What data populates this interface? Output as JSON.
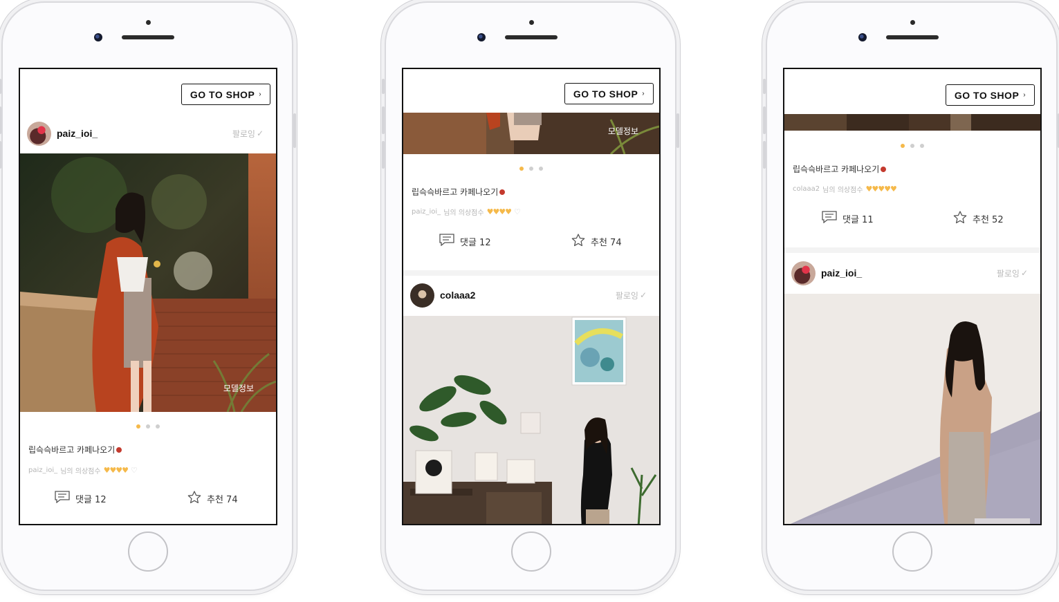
{
  "shop_button": {
    "label": "GO TO SHOP",
    "chevron": "›"
  },
  "follow_label": "팔로잉",
  "follow_icon": "✓",
  "model_info": "모델정보",
  "caption": "립슥슥바르고 카페나오기",
  "score_suffix": "님의 의상점수",
  "comment_icon": "comment-icon",
  "star_icon": "star-icon",
  "accent_color": "#f5b94a",
  "phones": [
    {
      "post": {
        "username": "paiz_ioi_",
        "score_user": "paiz_ioi_",
        "hearts_filled": "♥♥♥♥",
        "hearts_empty": "♡",
        "comments": "댓글 12",
        "likes": "추천 74"
      }
    },
    {
      "post": {
        "score_user": "paiz_ioi_",
        "hearts_filled": "♥♥♥♥",
        "hearts_empty": "♡",
        "comments": "댓글 12",
        "likes": "추천 74"
      },
      "next_post": {
        "username": "colaaa2"
      }
    },
    {
      "post": {
        "score_user": "colaaa2",
        "hearts_filled": "♥♥♥♥♥",
        "comments": "댓글 11",
        "likes": "추천 52"
      },
      "next_post": {
        "username": "paiz_ioi_"
      }
    }
  ]
}
